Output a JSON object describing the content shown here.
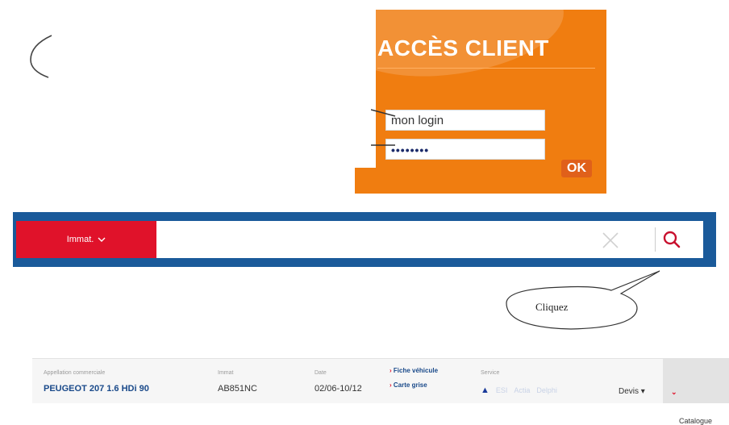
{
  "login": {
    "title": "ACCÈS CLIENT",
    "login_value": "mon login",
    "password_value": "••••••••",
    "ok_label": "OK"
  },
  "search": {
    "mode_label": "Immat.",
    "mode_chevron": "v",
    "clear_icon": "x-icon",
    "search_icon": "magnifier-icon"
  },
  "callout": {
    "text": "Cliquez"
  },
  "vehicle": {
    "appellation_label": "Appellation commerciale",
    "appellation_value": "PEUGEOT 207 1.6 HDi 90",
    "immat_label": "Immat",
    "immat_value": "AB851NC",
    "date_label": "Date",
    "date_value": "02/06-10/12",
    "link_fiche": "Fiche véhicule",
    "link_carte": "Carte grise",
    "service_label": "Service",
    "service_items": [
      "ESI",
      "Actia",
      "Delphi"
    ],
    "devis_label": "Devis",
    "catalogue_label": "Catalogue"
  },
  "colors": {
    "login_orange": "#f07d10",
    "search_bar_blue": "#1a5a9a",
    "immat_red": "#e0122a"
  }
}
